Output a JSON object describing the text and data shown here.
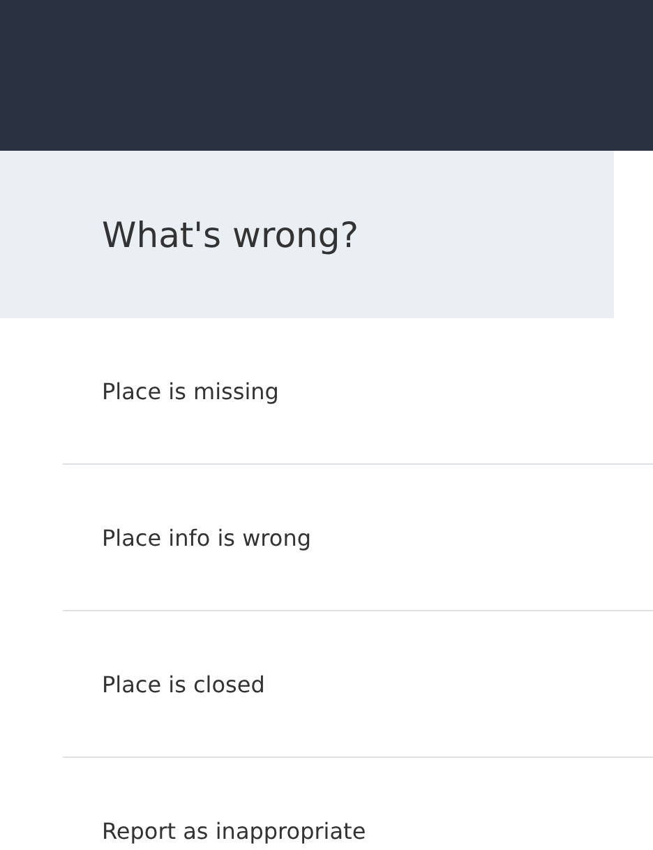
{
  "heading": "What's wrong?",
  "options": [
    {
      "label": "Place is missing"
    },
    {
      "label": "Place info is wrong"
    },
    {
      "label": "Place is closed"
    },
    {
      "label": "Report as inappropriate"
    }
  ]
}
